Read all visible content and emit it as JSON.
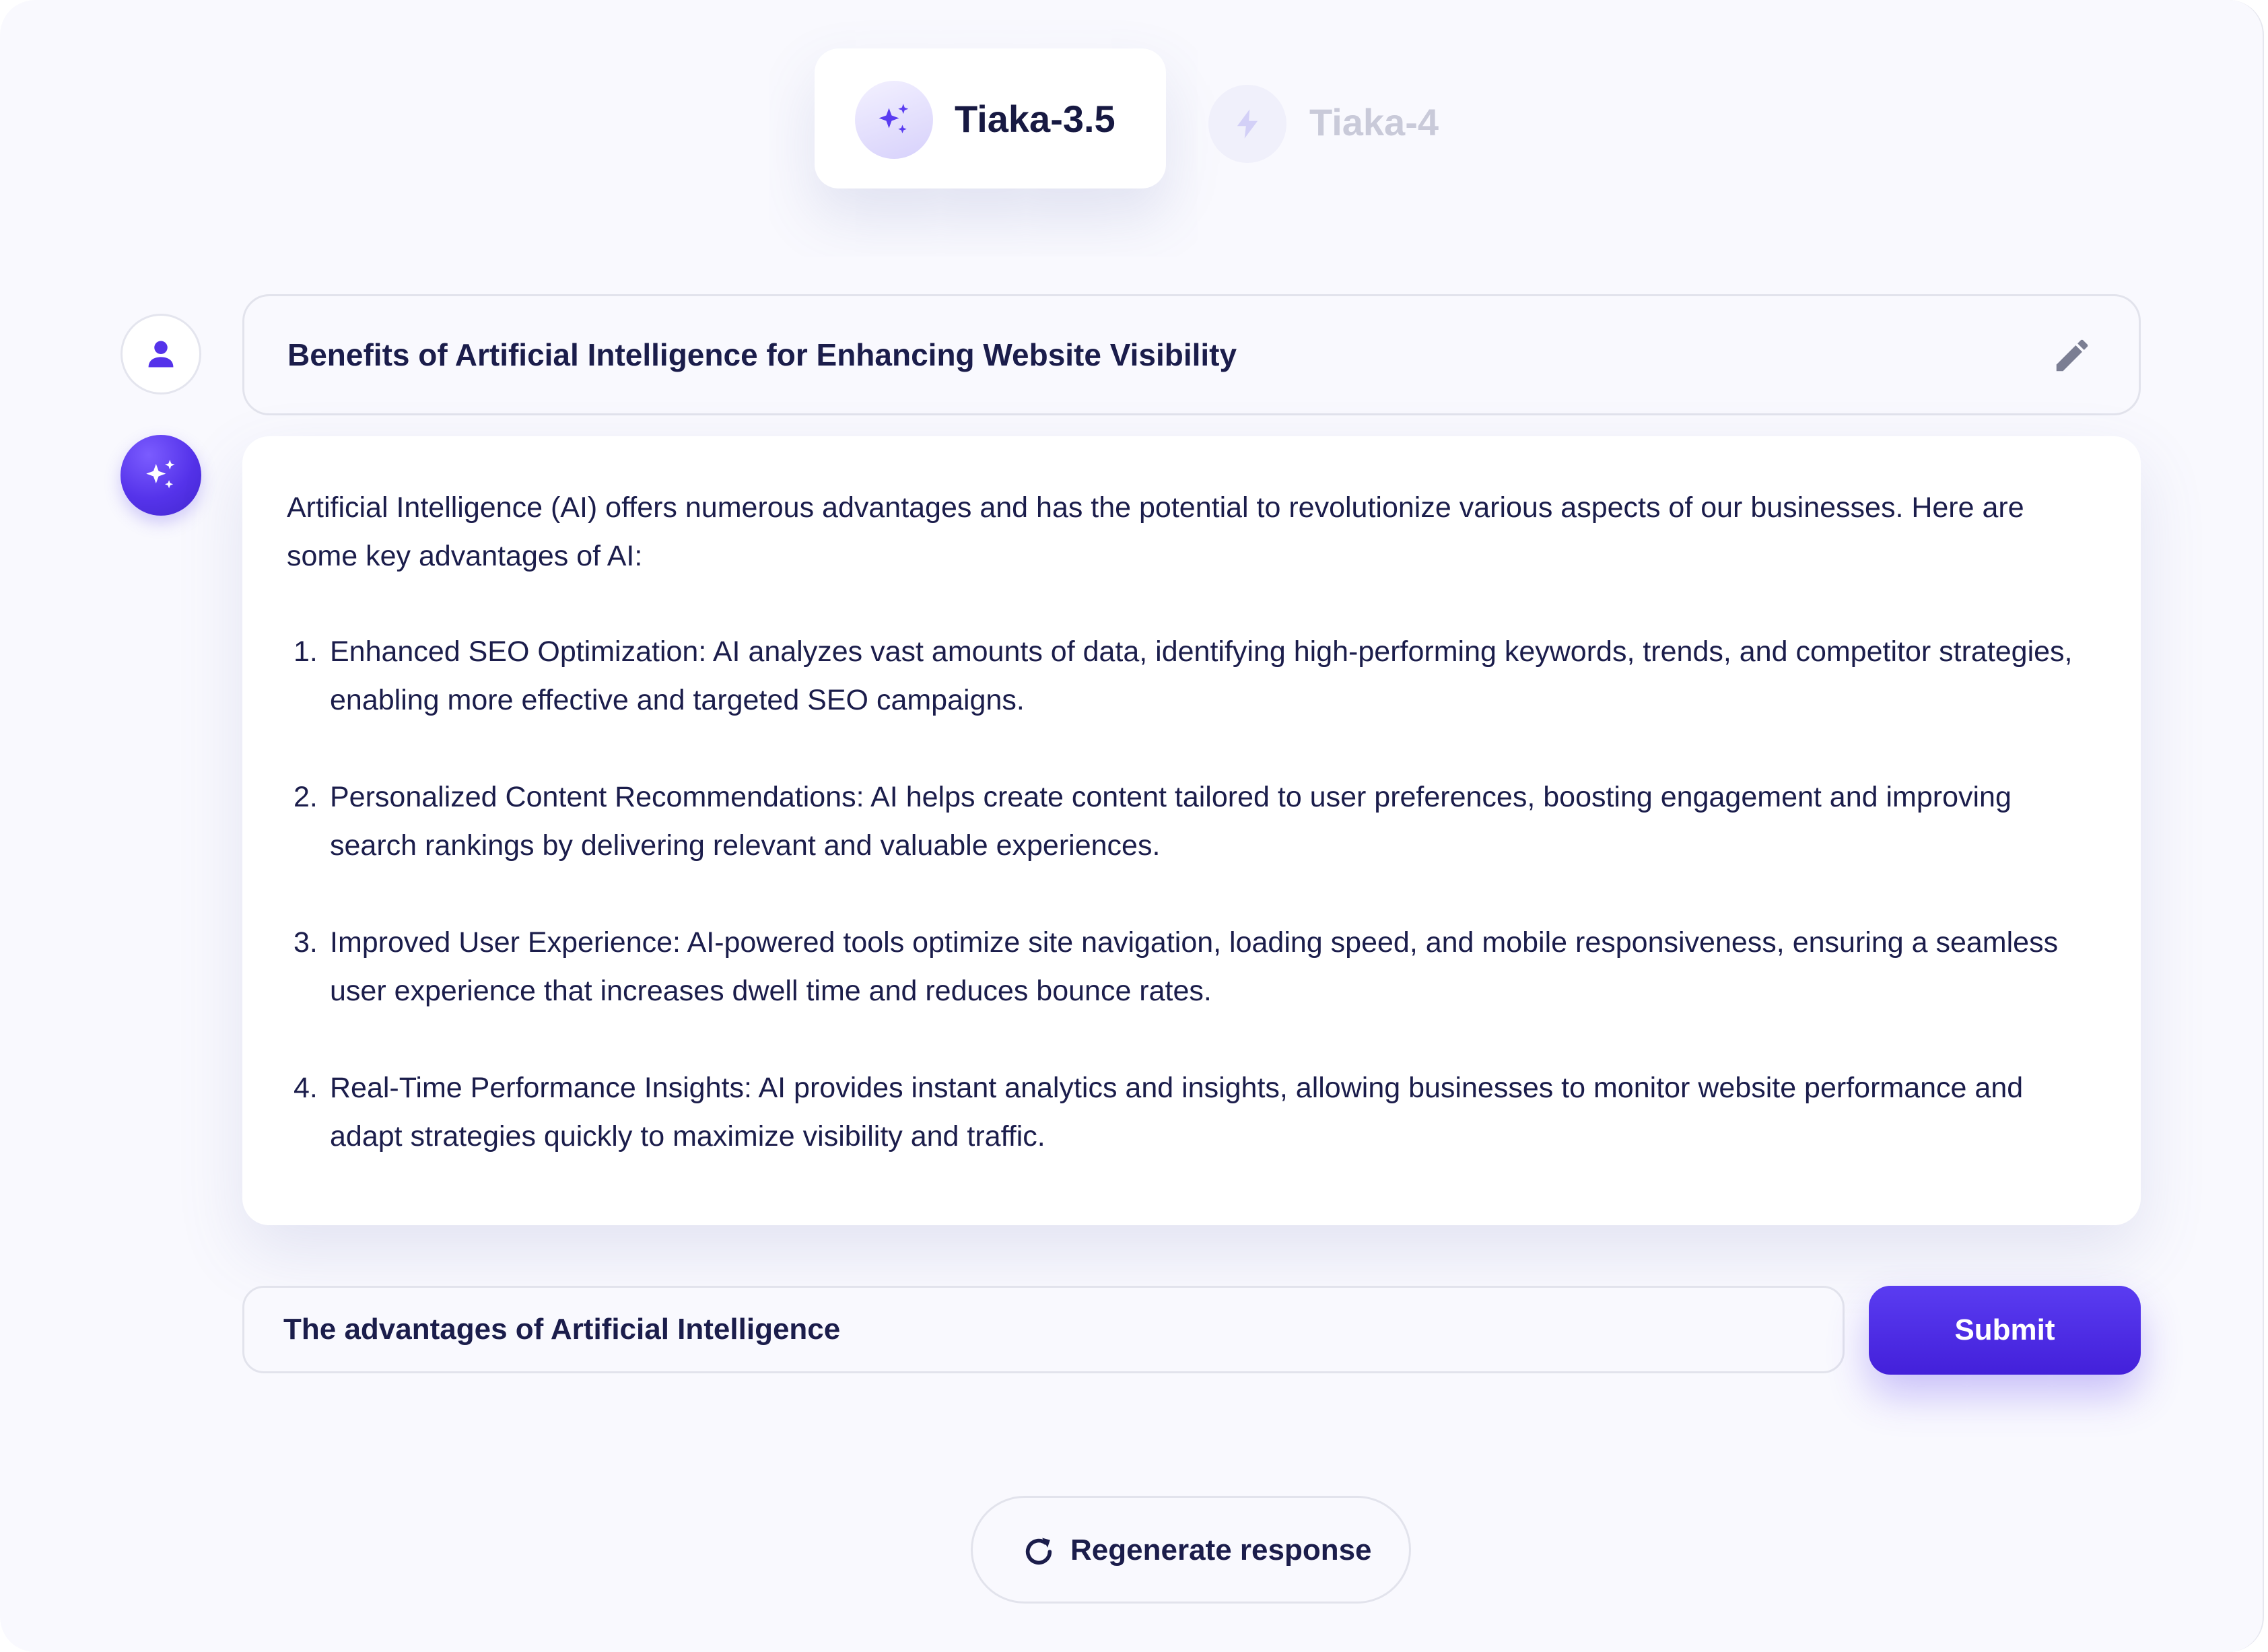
{
  "models": {
    "active": {
      "label": "Tiaka-3.5",
      "icon": "sparkles-icon"
    },
    "inactive": {
      "label": "Tiaka-4",
      "icon": "lightning-icon"
    }
  },
  "conversation": {
    "prompt": "Benefits of Artificial Intelligence for Enhancing Website Visibility",
    "response": {
      "intro": "Artificial Intelligence (AI) offers numerous advantages and has the potential to revolutionize various aspects of our businesses. Here are some key advantages of AI:",
      "items": [
        {
          "num": "1.",
          "text": "Enhanced SEO Optimization: AI analyzes vast amounts of data, identifying high-performing keywords, trends, and competitor strategies, enabling more effective and targeted SEO campaigns."
        },
        {
          "num": "2.",
          "text": "Personalized Content Recommendations: AI helps create content tailored to user preferences, boosting engagement and improving search rankings by delivering relevant and valuable experiences."
        },
        {
          "num": "3.",
          "text": "Improved User Experience: AI-powered tools optimize site navigation, loading speed, and mobile responsiveness, ensuring a seamless user experience that increases dwell time and reduces bounce rates."
        },
        {
          "num": "4.",
          "text": "Real-Time Performance Insights: AI provides instant analytics and insights, allowing businesses to monitor website performance and adapt strategies quickly to maximize visibility and traffic."
        }
      ]
    }
  },
  "input": {
    "value": "The advantages of Artificial Intelligence",
    "submit_label": "Submit"
  },
  "regenerate": {
    "label": "Regenerate response"
  },
  "colors": {
    "accent": "#5533ea",
    "text": "#1b1d4b",
    "muted": "#c9cad9",
    "background": "#f9f9fe"
  }
}
